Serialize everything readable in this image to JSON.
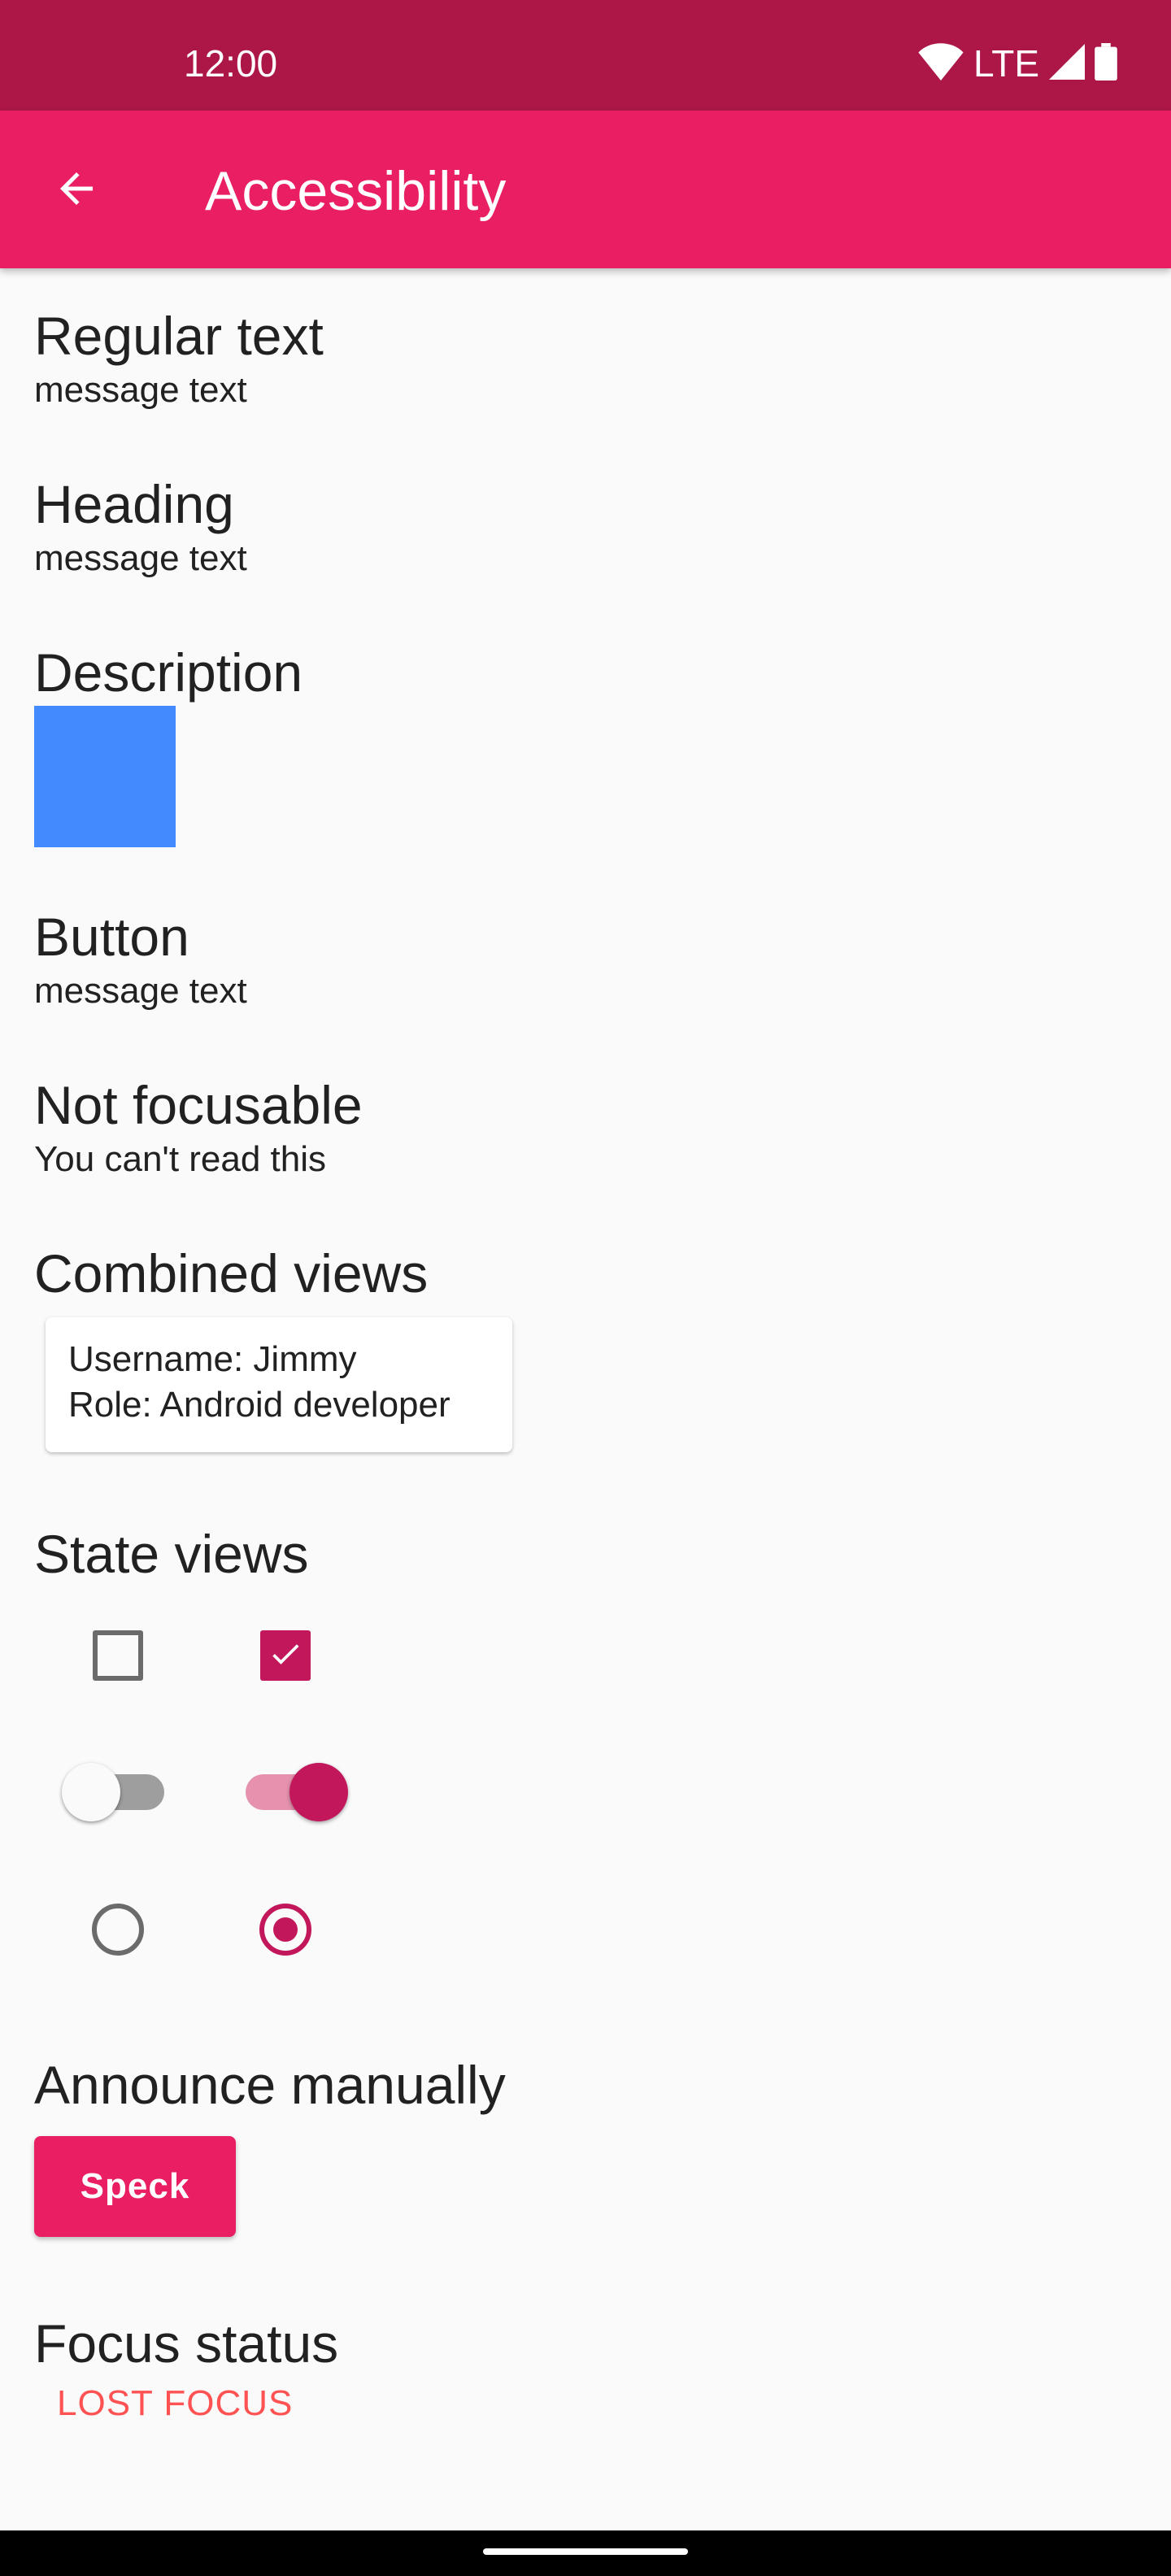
{
  "status_bar": {
    "time": "12:00",
    "network": "LTE",
    "icons": [
      "wifi-icon",
      "cell-signal-icon",
      "battery-icon"
    ]
  },
  "app_bar": {
    "title": "Accessibility",
    "back_icon": "arrow-back-icon"
  },
  "sections": {
    "regular": {
      "heading": "Regular text",
      "message": "message text"
    },
    "heading": {
      "heading": "Heading",
      "message": "message text"
    },
    "description": {
      "heading": "Description",
      "image_color": "#448aff"
    },
    "button": {
      "heading": "Button",
      "message": "message text"
    },
    "not_focusable": {
      "heading": "Not focusable",
      "message": "You can't read this"
    },
    "combined": {
      "heading": "Combined views",
      "username": "Username: Jimmy",
      "role": "Role: Android developer"
    },
    "state_views": {
      "heading": "State views",
      "checkboxes": [
        false,
        true
      ],
      "switches": [
        false,
        true
      ],
      "radios": [
        false,
        true
      ]
    },
    "announce": {
      "heading": "Announce manually",
      "button_label": "Speck"
    },
    "focus": {
      "heading": "Focus status",
      "status": "LOST FOCUS"
    }
  },
  "colors": {
    "status_bar": "#ad1748",
    "app_bar": "#e91e63",
    "accent": "#c2185b",
    "focus_status": "#ff5252"
  }
}
